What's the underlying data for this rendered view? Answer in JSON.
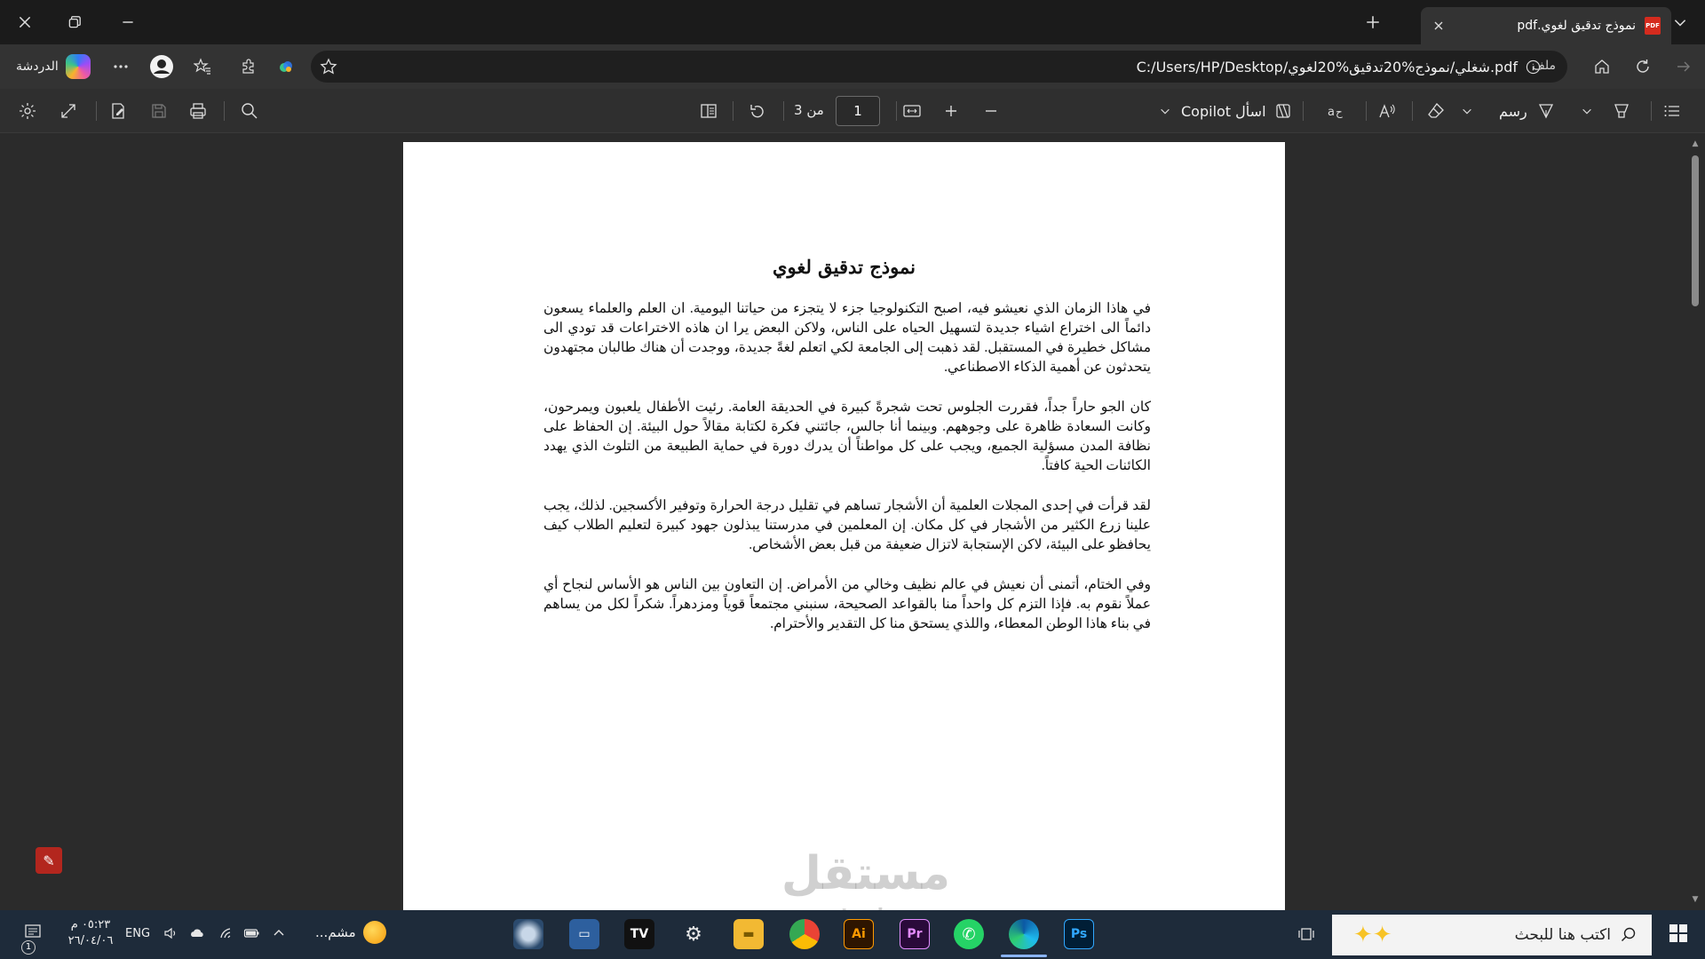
{
  "tab": {
    "title": "نموذج تدقيق لغوي.pdf",
    "favicon_label": "PDF"
  },
  "address": {
    "file_label": "ملف",
    "url": "C:/Users/HP/Desktop/شغلي/نموذج%20تدقيق%20لغوي.pdf"
  },
  "copilot_chat": {
    "label": "الدردشة"
  },
  "pdf_toolbar": {
    "draw_label": "رسم",
    "ask_copilot_label": "اسأل Copilot",
    "page_current": "1",
    "page_of": "من 3"
  },
  "document": {
    "title": "نموذج تدقيق لغوي",
    "paragraphs": [
      "في هاذا الزمان الذي نعيشو فيه، اصبح التكنولوجيا جزء لا يتجزء من حياتنا اليومية. ان العلم والعلماء يسعون دائماً الى اختراع اشياء جديدة لتسهيل الحياه على الناس، ولاكن البعض يرا ان هاذه الاختراعات قد تودي الى مشاكل خطيرة في المستقبل. لقد ذهبت إلى الجامعة لكي اتعلم لغةً جديدة، ووجدت أن هناك طالبان مجتهدون يتحدثون عن أهمية الذكاء الاصطناعي.",
      "كان الجو حاراً جداً، فقررت الجلوس تحت شجرةً كبيرة في الحديقة العامة. رئيت الأطفال يلعبون ويمرحون، وكانت السعادة ظاهرة على وجوههم. وبينما أنا جالس، جائتني فكرة لكتابة مقالاً حول البيئة. إن الحفاظ على نظافة المدن مسؤلية الجميع، ويجب على كل مواطناً أن يدرك دورة في حماية الطبيعة من التلوث الذي يهدد الكائنات الحية كافتاً.",
      "لقد قرأت في إحدى المجلات العلمية أن الأشجار تساهم في تقليل درجة الحرارة وتوفير الأكسجين. لذلك، يجب علينا زرع الكثير من الأشجار في كل مكان. إن المعلمين في مدرستنا يبذلون جهود كبيرة لتعليم الطلاب كيف يحافظو على البيئة، لاكن الإستجابة لاتزال ضعيفة من قبل بعض الأشخاص.",
      "وفي الختام، أتمنى أن نعيش في عالم نظيف وخالي من الأمراض. إن التعاون بين الناس هو الأساس لنجاح أي عملاً نقوم به. فإذا التزم كل واحداً منا بالقواعد الصحيحة، سنبني مجتمعاً قوياً ومزدهراً. شكراً لكل من يساهم في بناء هاذا الوطن المعطاء، واللذي يستحق منا كل التقدير والأحترام."
    ]
  },
  "watermark": {
    "text": "مستقل",
    "sub": "mostaql.com"
  },
  "taskbar": {
    "search_placeholder": "اكتب هنا للبحث",
    "weather_label": "مشم...",
    "language": "ENG",
    "clock_time": "٠٥:٢٣ م",
    "clock_date": "٢٦/٠٤/٠٦",
    "notification_count": "1"
  }
}
